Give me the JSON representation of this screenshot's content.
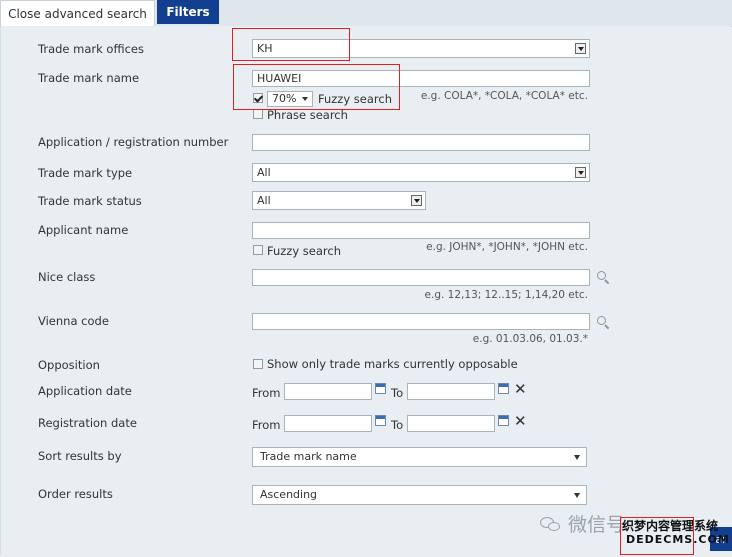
{
  "tabs": {
    "close_label": "Close advanced search",
    "filters_label": "Filters"
  },
  "fields": {
    "offices": {
      "label": "Trade mark offices",
      "value": "KH"
    },
    "name": {
      "label": "Trade mark name",
      "value": "HUAWEI",
      "fuzzy_percent": "70%",
      "fuzzy_label": "Fuzzy search",
      "fuzzy_checked": true,
      "phrase_label": "Phrase search",
      "hint": "e.g. COLA*, *COLA, *COLA* etc."
    },
    "appnum": {
      "label": "Application / registration number",
      "value": ""
    },
    "type": {
      "label": "Trade mark type",
      "value": "All"
    },
    "status": {
      "label": "Trade mark status",
      "value": "All"
    },
    "applicant": {
      "label": "Applicant name",
      "value": "",
      "fuzzy_label": "Fuzzy search",
      "hint": "e.g. JOHN*, *JOHN*, *JOHN etc."
    },
    "nice": {
      "label": "Nice class",
      "value": "",
      "hint": "e.g. 12,13; 12..15; 1,14,20 etc."
    },
    "vienna": {
      "label": "Vienna code",
      "value": "",
      "hint": "e.g. 01.03.06, 01.03.*"
    },
    "opposition": {
      "label": "Opposition",
      "checkbox_label": "Show only trade marks currently opposable"
    },
    "appdate": {
      "label": "Application date",
      "from_label": "From",
      "to_label": "To"
    },
    "regdate": {
      "label": "Registration date",
      "from_label": "From",
      "to_label": "To"
    },
    "sort": {
      "label": "Sort results by",
      "value": "Trade mark name"
    },
    "order": {
      "label": "Order results",
      "value": "Ascending"
    }
  },
  "watermark": {
    "text": "微信号",
    "logo_top": "织梦内容管理系统",
    "logo_bottom": "DEDECMS.COM"
  },
  "colors": {
    "accent": "#123f8f",
    "highlight": "#e02020"
  }
}
